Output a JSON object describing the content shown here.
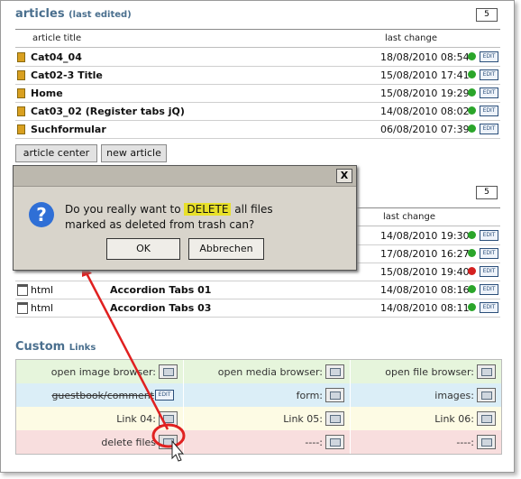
{
  "articles": {
    "title": "articles",
    "subtitle": "(last edited)",
    "count": "5",
    "col_title": "article title",
    "col_change": "last change",
    "rows": [
      {
        "name": "Cat04_04",
        "date": "18/08/2010 08:54",
        "edit": "EDIT"
      },
      {
        "name": "Cat02-3 Title",
        "date": "15/08/2010 17:41",
        "edit": "EDIT"
      },
      {
        "name": "Home",
        "date": "15/08/2010 19:29",
        "edit": "EDIT"
      },
      {
        "name": "Cat03_02 (Register tabs jQ)",
        "date": "14/08/2010 08:02",
        "edit": "EDIT"
      },
      {
        "name": "Suchformular",
        "date": "06/08/2010 07:39",
        "edit": "EDIT"
      }
    ],
    "btn_center": "article center",
    "btn_new": "new article"
  },
  "content": {
    "count": "5",
    "col_change": "last change",
    "rows": [
      {
        "type": "",
        "name": "",
        "date": "14/08/2010 19:30",
        "edit": "EDIT"
      },
      {
        "type": "",
        "name": "",
        "date": "17/08/2010 16:27",
        "edit": "EDIT"
      },
      {
        "type": "",
        "name": "",
        "date": "15/08/2010 19:40",
        "edit": "EDIT"
      },
      {
        "type": "html",
        "name": "Accordion Tabs 01",
        "date": "14/08/2010 08:16",
        "edit": "EDIT"
      },
      {
        "type": "html",
        "name": "Accordion Tabs 03",
        "date": "14/08/2010 08:11",
        "edit": "EDIT"
      }
    ]
  },
  "custom": {
    "title": "Custom",
    "subtitle": "Links",
    "cells": [
      {
        "label": "open image browser:"
      },
      {
        "label": "open media browser:"
      },
      {
        "label": "open file browser:"
      },
      {
        "label": "guestbook/comment",
        "edit": "EDIT"
      },
      {
        "label": "form:"
      },
      {
        "label": "images:"
      },
      {
        "label": "Link 04:"
      },
      {
        "label": "Link 05:"
      },
      {
        "label": "Link 06:"
      },
      {
        "label": "delete files"
      },
      {
        "label": "----:"
      },
      {
        "label": "----:"
      }
    ]
  },
  "dialog": {
    "close": "X",
    "msg_pre": "Do you really want to",
    "msg_hl": "DELETE",
    "msg_post": "all files",
    "msg_line2": "marked as deleted from trash can?",
    "ok": "OK",
    "cancel": "Abbrechen"
  },
  "colors": {
    "title": "#4a6f8e",
    "row_green": "#e6f5dc",
    "row_blue": "#dbeef7",
    "row_yellow": "#fdfbe4",
    "row_red": "#f8dede",
    "highlight": "#e8e02a",
    "annotation": "#e02020"
  }
}
